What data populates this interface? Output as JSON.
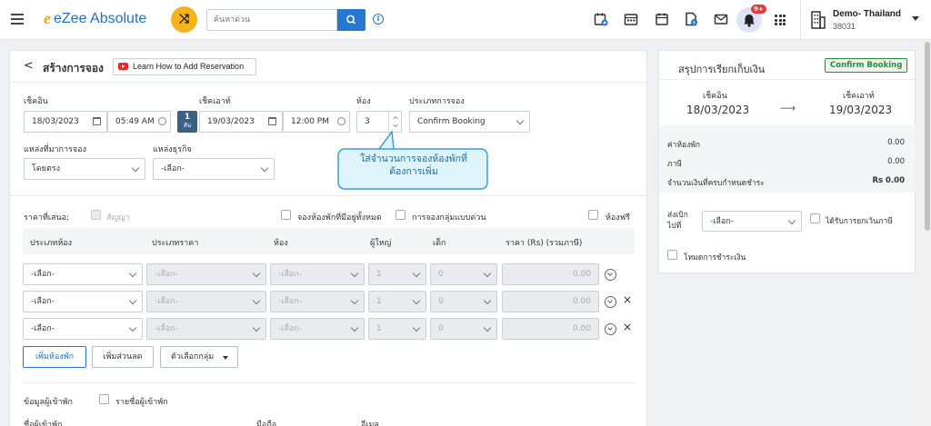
{
  "topbar": {
    "logo_text": "eZee Absolute",
    "logo_mark": "e",
    "search_placeholder": "ค้นหาด่วน",
    "notification_count": "9+",
    "hotel_name": "Demo- Thailand",
    "hotel_id": "38031"
  },
  "header": {
    "back_symbol": "<",
    "title": "สร้างการจอง",
    "learn_label": "Learn How to Add Reservation"
  },
  "stay": {
    "checkin_label": "เช็คอิน",
    "checkin_date": "18/03/2023",
    "checkin_time": "05:49 AM",
    "nights_value": "1",
    "nights_unit": "คืน",
    "checkout_label": "เช็คเอาท์",
    "checkout_date": "19/03/2023",
    "checkout_time": "12:00 PM",
    "rooms_label": "ห้อง",
    "rooms_value": "3",
    "booking_type_label": "ประเภทการจอง",
    "booking_type_value": "Confirm Booking",
    "source_label": "แหล่งที่มาการจอง",
    "source_value": "โดยตรง",
    "business_label": "แหล่งธุรกิจ",
    "business_value": "-เลือก-"
  },
  "tooltip": {
    "line1": "ใส่จำนวนการจองห้องพักที่",
    "line2": "ต้องการเพิ่ม"
  },
  "options": {
    "rate_label": "ราคาที่เสนอ:",
    "contract_label": "สัญญา",
    "book_all_label": "จองห้องพักที่มีอยู่ทั้งหมด",
    "group_label": "การจองกลุ่มแบบด่วน",
    "free_label": "ห้องฟรี"
  },
  "room_table": {
    "headers": [
      "ประเภทห้อง",
      "ประเภทราคา",
      "ห้อง",
      "ผู้ใหญ่",
      "เด็ก",
      "ราคา (Rs)  (รวมภาษี)"
    ],
    "rows": [
      {
        "room_type": "-เลือก-",
        "rate_type": "-เลือก-",
        "room": "-เลือก-",
        "adult": "1",
        "child": "0",
        "price": "0.00",
        "remove": ""
      },
      {
        "room_type": "-เลือก-",
        "rate_type": "-เลือก-",
        "room": "-เลือก-",
        "adult": "1",
        "child": "0",
        "price": "0.00",
        "remove": "×"
      },
      {
        "room_type": "-เลือก-",
        "rate_type": "-เลือก-",
        "room": "-เลือก-",
        "adult": "1",
        "child": "0",
        "price": "0.00",
        "remove": "×"
      }
    ]
  },
  "actions": {
    "add_room": "เพิ่มห้องพัก",
    "add_discount": "เพิ่มส่วนลด",
    "group_select": "ตัวเลือกกลุ่ม"
  },
  "guest": {
    "section_label": "ข้อมูลผู้เข้าพัก",
    "guest_list_label": "รายชื่อผู้เข้าพัก",
    "name_label": "ชื่อผู้เข้าพัก",
    "mobile_label": "มือถือ",
    "email_label": "อีเมล"
  },
  "summary": {
    "title": "สรุปการเรียกเก็บเงิน",
    "status_badge": "Confirm Booking",
    "checkin_label": "เช็คอิน",
    "checkin_date": "18/03/2023",
    "arrow": "⟶",
    "checkout_label": "เช็คเอาท์",
    "checkout_date": "19/03/2023",
    "room_charge_label": "ค่าห้องพัก",
    "room_charge_value": "0.00",
    "tax_label": "ภาษี",
    "tax_value": "0.00",
    "due_label": "จำนวนเงินที่ครบกำหนดชำระ",
    "due_value": "Rs 0.00",
    "bill_to_label_1": "ส่งเบิก",
    "bill_to_label_2": "ไปที่",
    "bill_to_value": "-เลือก-",
    "tax_exempt_label": "ได้รับการยกเว้นภาษี",
    "payment_mode_label": "โหมดการชำระเงิน"
  },
  "colors": {
    "brand_blue": "#1f73c8",
    "accent_yellow": "#f5b41c",
    "nights_badge": "#3b5f85",
    "badge_green": "#2e8b3a",
    "tooltip_bg": "#dff3fb",
    "tooltip_border": "#3aa1cf",
    "youtube_red": "#e52d27"
  },
  "icons": [
    "menu-icon",
    "shuffle-icon",
    "search-icon",
    "info-icon",
    "new-booking-icon",
    "calendar-grid-icon",
    "calendar-icon",
    "invoice-icon",
    "mail-icon",
    "bell-icon",
    "apps-grid-icon",
    "building-icon",
    "youtube-icon"
  ]
}
